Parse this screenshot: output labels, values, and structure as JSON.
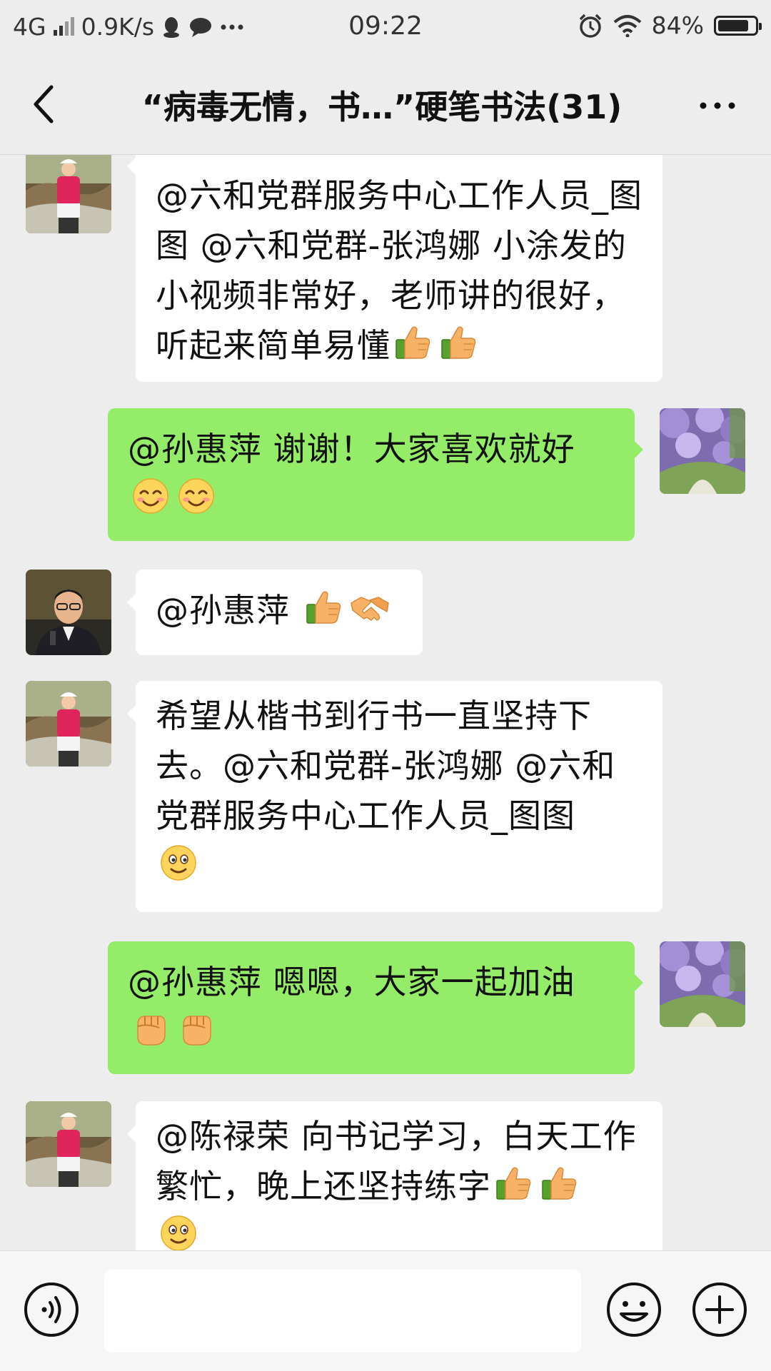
{
  "status_bar": {
    "network": "4G",
    "speed": "0.9K/s",
    "time": "09:22",
    "battery_percent": "84%",
    "battery_level": 0.84,
    "icons": [
      "signal-icon",
      "qq-icon",
      "chat-icon",
      "more-dots-icon",
      "alarm-icon",
      "wifi-icon",
      "battery-icon"
    ]
  },
  "header": {
    "title": "“病毒无情，书…”硬笔书法(31)",
    "back_icon": "chevron-left-icon",
    "more_icon": "more-horizontal-icon"
  },
  "messages": [
    {
      "side": "left",
      "avatar": "avatar-woman-red",
      "text": "@六和党群服务中心工作人员_图图 @六和党群-张鸿娜 小涂发的小视频非常好，老师讲的很好，听起来简单易懂",
      "emojis": [
        "thumbs-up-emoji",
        "thumbs-up-emoji"
      ]
    },
    {
      "side": "right",
      "avatar": "avatar-wisteria",
      "text": "@孙惠萍  谢谢！大家喜欢就好",
      "emojis": [
        "smile-emoji",
        "smile-emoji"
      ]
    },
    {
      "side": "left",
      "avatar": "avatar-man-suit",
      "text": "@孙惠萍 ",
      "emojis": [
        "thumbs-up-emoji",
        "handshake-emoji"
      ]
    },
    {
      "side": "left",
      "avatar": "avatar-woman-red",
      "text": "希望从楷书到行书一直坚持下去。@六和党群-张鸿娜 @六和党群服务中心工作人员_图图",
      "emojis": [
        "grin-emoji"
      ]
    },
    {
      "side": "right",
      "avatar": "avatar-wisteria",
      "text": "@孙惠萍  嗯嗯，大家一起加油",
      "emojis": [
        "fist-emoji",
        "fist-emoji"
      ]
    },
    {
      "side": "left",
      "avatar": "avatar-woman-red",
      "text": "@陈禄荣  向书记学习，白天工作繁忙，晚上还坚持练字",
      "emojis": [
        "thumbs-up-emoji",
        "thumbs-up-emoji",
        "grin-emoji"
      ]
    }
  ],
  "input_bar": {
    "placeholder": "",
    "voice_icon": "voice-icon",
    "emoji_icon": "emoji-face-icon",
    "plus_icon": "plus-circle-icon"
  },
  "colors": {
    "background": "#ededed",
    "bubble_self": "#95ec69",
    "bubble_other": "#ffffff"
  }
}
